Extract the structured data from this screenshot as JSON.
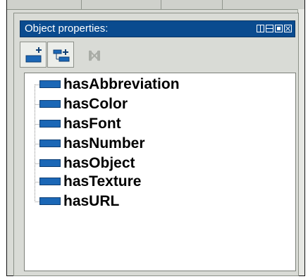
{
  "panel": {
    "title": "Object properties:",
    "window_controls": [
      "tile-vertical-icon",
      "tile-horizontal-icon",
      "maximize-icon",
      "close-icon"
    ]
  },
  "toolbar": {
    "buttons": [
      {
        "name": "add-property-button",
        "icon": "add-property-icon",
        "enabled": true
      },
      {
        "name": "add-subproperty-button",
        "icon": "add-subproperty-icon",
        "enabled": true
      },
      {
        "name": "delete-property-button",
        "icon": "delete-property-icon",
        "enabled": false
      }
    ]
  },
  "properties": {
    "items": [
      {
        "label": "hasAbbreviation"
      },
      {
        "label": "hasColor"
      },
      {
        "label": "hasFont"
      },
      {
        "label": "hasNumber"
      },
      {
        "label": "hasObject"
      },
      {
        "label": "hasTexture"
      },
      {
        "label": "hasURL"
      }
    ]
  },
  "colors": {
    "titlebar": "#0a4b8f",
    "property_icon": "#1b67b6",
    "panel_bg": "#d9dbd6"
  }
}
